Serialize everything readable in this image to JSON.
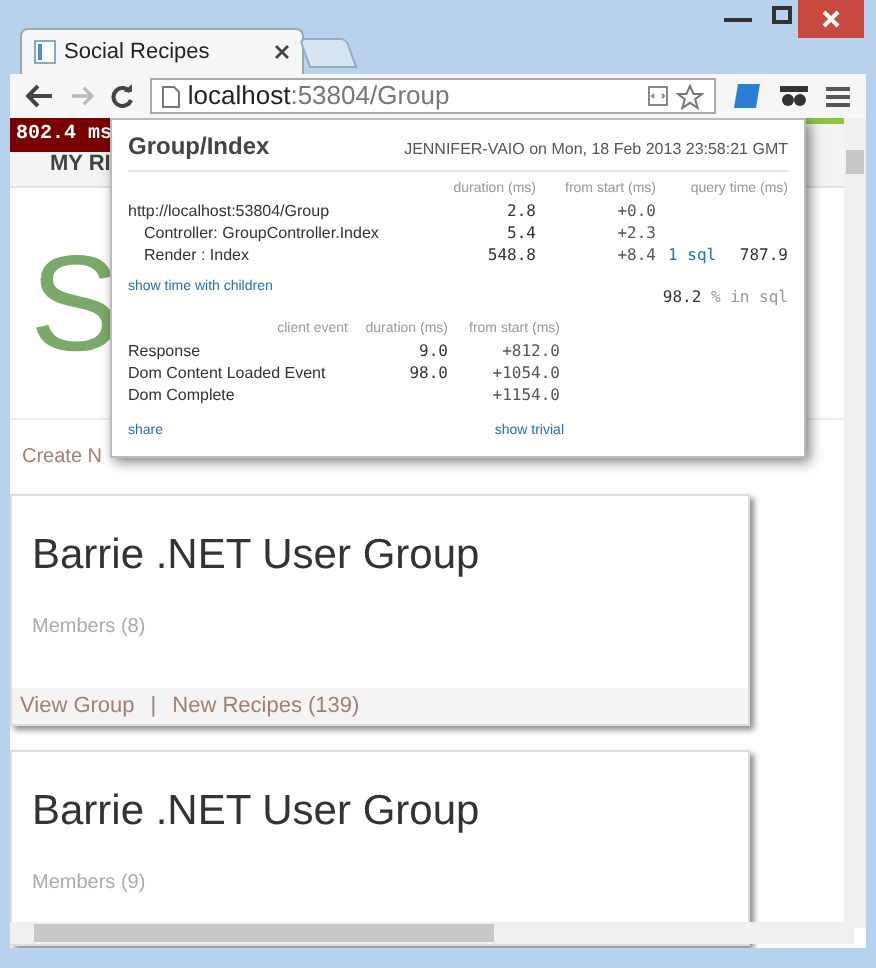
{
  "window": {
    "title": "Social Recipes"
  },
  "address_bar": {
    "host": "localhost",
    "path": ":53804/Group"
  },
  "profiler_badge": "802.4 ms",
  "nav": {
    "label": "MY RI"
  },
  "hero_title": "S",
  "create_link": "Create N",
  "groups": [
    {
      "title": "Barrie .NET User Group",
      "members": "Members (8)",
      "footer": {
        "links": [
          "View Group",
          "New Recipes (139)"
        ],
        "separator": "|"
      }
    },
    {
      "title": "Barrie .NET User Group",
      "members": "Members (9)"
    }
  ],
  "profiler": {
    "title": "Group/Index",
    "machine": "JENNIFER-VAIO on Mon, 18 Feb 2013 23:58:21 GMT",
    "server_columns": [
      "duration (ms)",
      "from start (ms)",
      "query time (ms)"
    ],
    "server_rows": [
      {
        "name": "http://localhost:53804/Group",
        "duration": "2.8",
        "from_start": "+0.0",
        "children": [
          {
            "name": "Controller: GroupController.Index",
            "duration": "5.4",
            "from_start": "+2.3"
          },
          {
            "name": "Render : Index",
            "duration": "548.8",
            "from_start": "+8.4",
            "sql": "1 sql",
            "query_time": "787.9"
          }
        ]
      }
    ],
    "children_link": "show time with children",
    "sql_percent": "98.2",
    "sql_label": "% in sql",
    "client_columns": [
      "client event",
      "duration (ms)",
      "from start (ms)"
    ],
    "client_rows": [
      {
        "name": "Response",
        "duration": "9.0",
        "from_start": "+812.0"
      },
      {
        "name": "Dom Content Loaded Event",
        "duration": "98.0",
        "from_start": "+1054.0"
      },
      {
        "name": "Dom Complete",
        "from_start": "+1154.0"
      }
    ],
    "share_link": "share",
    "trivial_link": "show trivial"
  }
}
